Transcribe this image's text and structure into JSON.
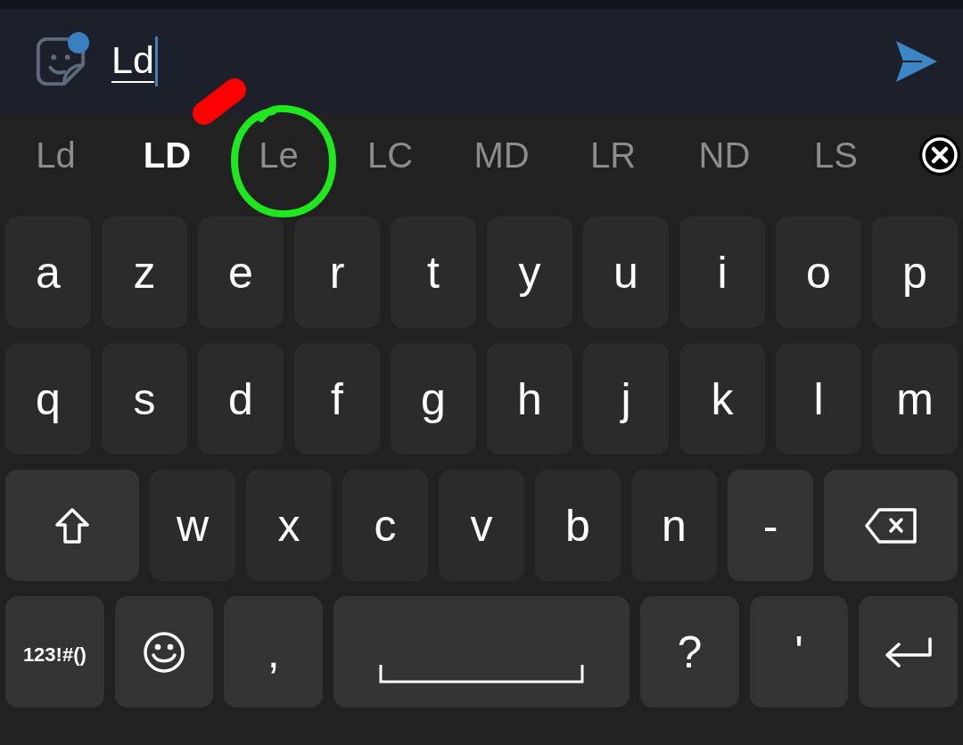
{
  "composer": {
    "value": "Ld",
    "composing": true,
    "sticker_badge": true
  },
  "suggestions": [
    {
      "text": "Ld",
      "selected": false
    },
    {
      "text": "LD",
      "selected": true
    },
    {
      "text": "Le",
      "selected": false
    },
    {
      "text": "LC",
      "selected": false
    },
    {
      "text": "MD",
      "selected": false
    },
    {
      "text": "LR",
      "selected": false
    },
    {
      "text": "ND",
      "selected": false
    },
    {
      "text": "LS",
      "selected": false
    }
  ],
  "keyboard": {
    "rows": [
      [
        {
          "kind": "letter",
          "label": "a"
        },
        {
          "kind": "letter",
          "label": "z"
        },
        {
          "kind": "letter",
          "label": "e"
        },
        {
          "kind": "letter",
          "label": "r"
        },
        {
          "kind": "letter",
          "label": "t"
        },
        {
          "kind": "letter",
          "label": "y"
        },
        {
          "kind": "letter",
          "label": "u"
        },
        {
          "kind": "letter",
          "label": "i"
        },
        {
          "kind": "letter",
          "label": "o"
        },
        {
          "kind": "letter",
          "label": "p"
        }
      ],
      [
        {
          "kind": "letter",
          "label": "q"
        },
        {
          "kind": "letter",
          "label": "s"
        },
        {
          "kind": "letter",
          "label": "d"
        },
        {
          "kind": "letter",
          "label": "f"
        },
        {
          "kind": "letter",
          "label": "g"
        },
        {
          "kind": "letter",
          "label": "h"
        },
        {
          "kind": "letter",
          "label": "j"
        },
        {
          "kind": "letter",
          "label": "k"
        },
        {
          "kind": "letter",
          "label": "l"
        },
        {
          "kind": "letter",
          "label": "m"
        }
      ],
      [
        {
          "kind": "shift"
        },
        {
          "kind": "letter",
          "label": "w"
        },
        {
          "kind": "letter",
          "label": "x"
        },
        {
          "kind": "letter",
          "label": "c"
        },
        {
          "kind": "letter",
          "label": "v"
        },
        {
          "kind": "letter",
          "label": "b"
        },
        {
          "kind": "letter",
          "label": "n"
        },
        {
          "kind": "symbol",
          "label": "-"
        },
        {
          "kind": "backspace"
        }
      ],
      [
        {
          "kind": "mode",
          "label": "123!#()"
        },
        {
          "kind": "emoji"
        },
        {
          "kind": "symbol",
          "label": ","
        },
        {
          "kind": "space"
        },
        {
          "kind": "symbol",
          "label": "?"
        },
        {
          "kind": "symbol",
          "label": "'"
        },
        {
          "kind": "enter"
        }
      ]
    ]
  },
  "annotations": [
    {
      "kind": "stroke",
      "color": "#ff0000"
    },
    {
      "kind": "circle",
      "color": "#1fe81f"
    }
  ]
}
